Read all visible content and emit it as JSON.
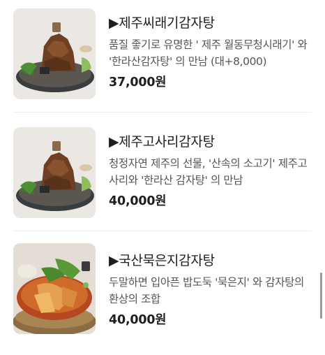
{
  "menu": {
    "items": [
      {
        "name": "▶제주씨래기감자탕",
        "description": "품질 좋기로 유명한 ' 제주 월동무청시래기' 와 '한라산감자탕' 의 만남 (대+8,000)",
        "price": "37,000원",
        "image": "pork-back-bone-stew-dish-image"
      },
      {
        "name": "▶제주고사리감자탕",
        "description": "청정자연 제주의 선물, '산속의 소고기' 제주고사리와 '한라산 감자탕' 의 만남",
        "price": "40,000원",
        "image": "pork-back-bone-stew-dish-image"
      },
      {
        "name": "▶국산묵은지감자탕",
        "description": "두말하면 입아픈 밥도둑 '묵은지' 와 감자탕의 환상의 조합",
        "price": "40,000원",
        "image": "kimchi-stew-pot-image"
      }
    ]
  },
  "colors": {
    "text": "#1e1e1e",
    "description": "#555555",
    "divider": "#eeeeee"
  }
}
